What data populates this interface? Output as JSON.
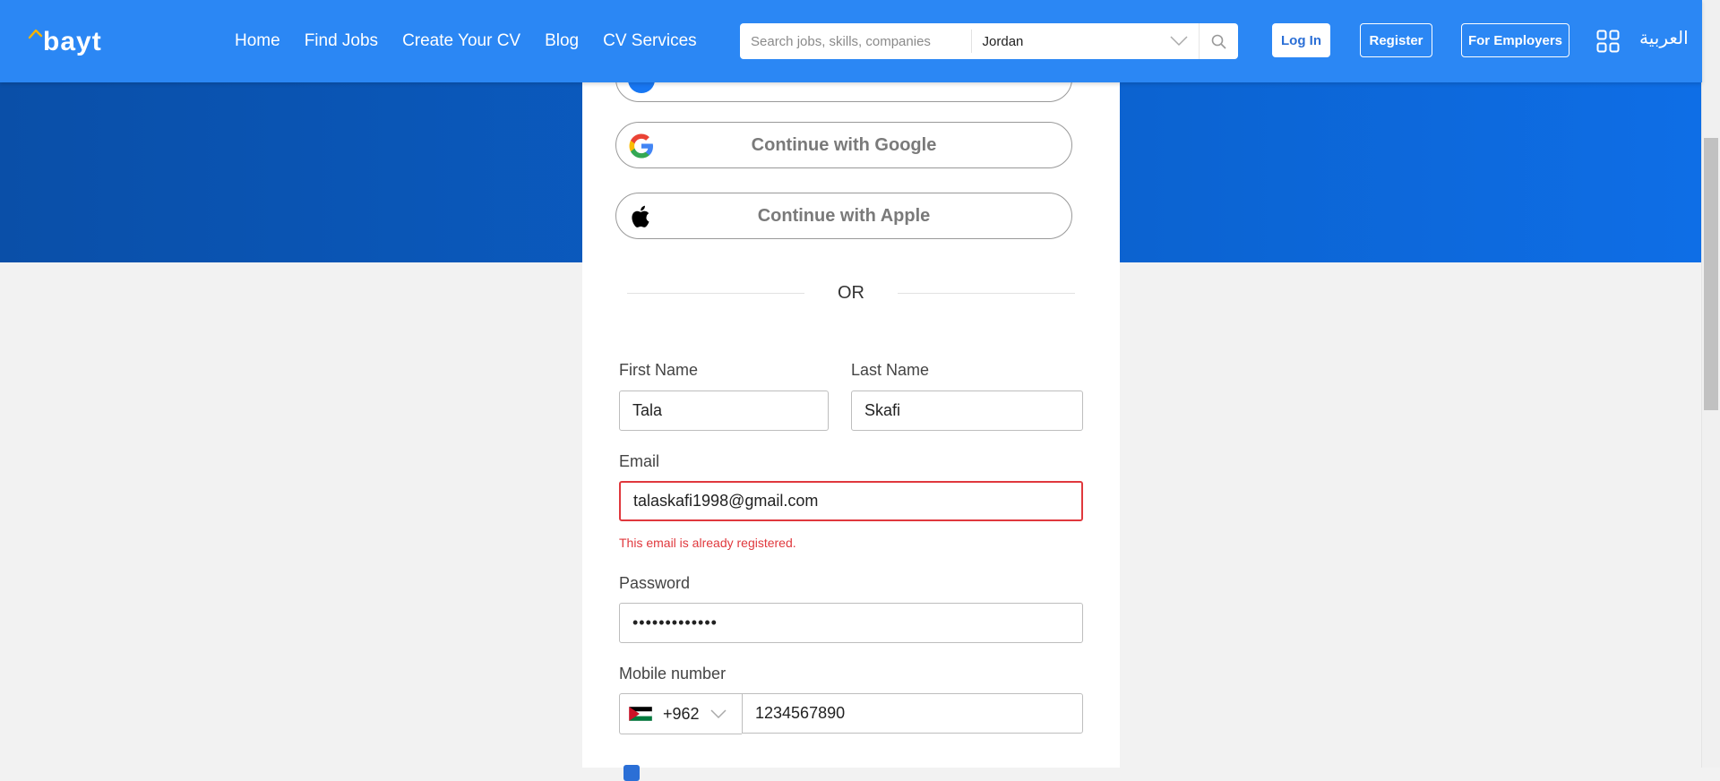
{
  "header": {
    "logo_text": "bayt",
    "nav": [
      "Home",
      "Find Jobs",
      "Create Your CV",
      "Blog",
      "CV Services"
    ],
    "search_placeholder": "Search jobs, skills, companies",
    "country": "Jordan",
    "login": "Log In",
    "register": "Register",
    "employers": "For Employers",
    "language": "العربية"
  },
  "social": {
    "google": "Continue with Google",
    "apple": "Continue with Apple"
  },
  "divider": "OR",
  "form": {
    "first_name_label": "First Name",
    "first_name_value": "Tala",
    "last_name_label": "Last Name",
    "last_name_value": "Skafi",
    "email_label": "Email",
    "email_value": "talaskafi1998@gmail.com",
    "email_error": "This email is already registered.",
    "password_label": "Password",
    "password_value": "•••••••••••••",
    "mobile_label": "Mobile number",
    "country_code": "+962",
    "mobile_value": "1234567890"
  },
  "colors": {
    "header": "#2b87f4",
    "hero": "#0b5fc9",
    "error": "#e0383d",
    "page_bg": "#f2f2f2"
  }
}
